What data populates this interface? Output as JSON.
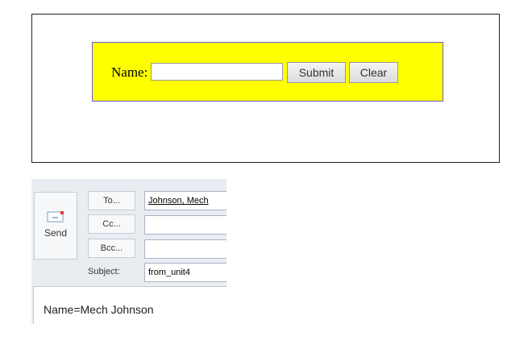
{
  "form": {
    "name_label": "Name:",
    "name_value": "",
    "submit_label": "Submit",
    "clear_label": "Clear",
    "background_color": "#ffff00"
  },
  "email": {
    "send_label": "Send",
    "to_label": "To...",
    "cc_label": "Cc...",
    "bcc_label": "Bcc...",
    "subject_label": "Subject:",
    "to_value": "Johnson, Mech",
    "cc_value": "",
    "bcc_value": "",
    "subject_value": "from_unit4",
    "body_text": "Name=Mech Johnson"
  }
}
